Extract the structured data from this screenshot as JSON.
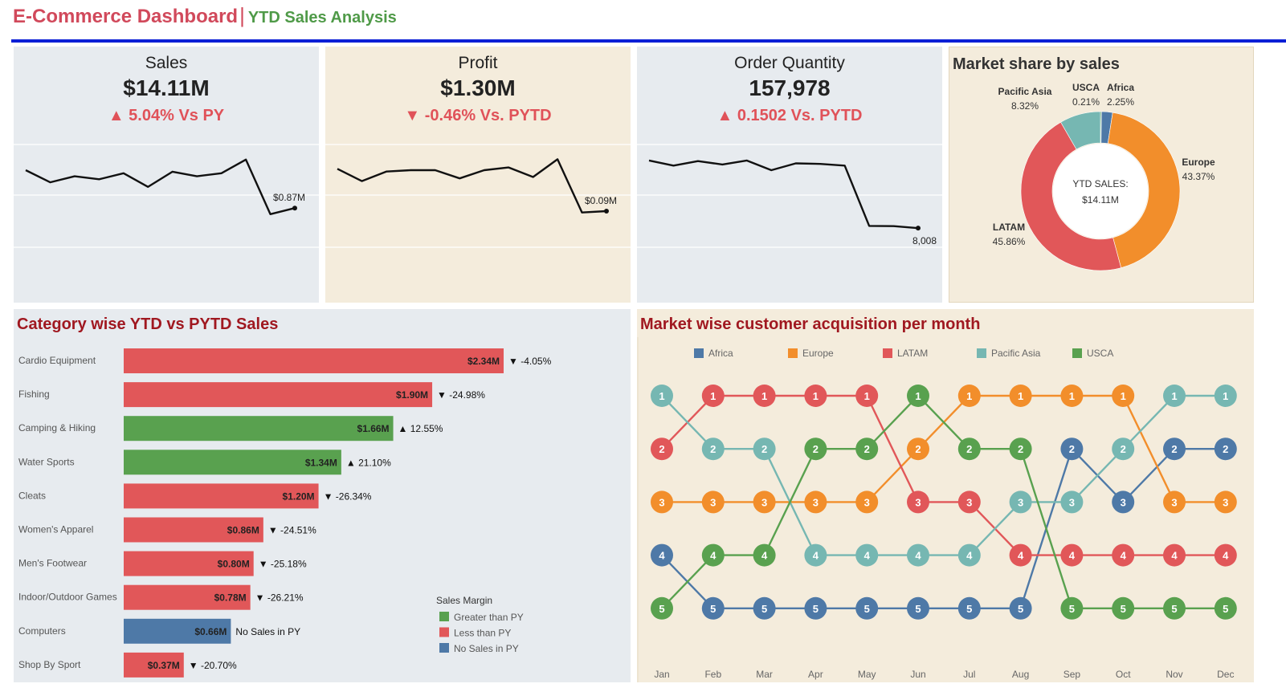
{
  "header": {
    "title": "E-Commerce Dashboard",
    "separator": "|",
    "subtitle": "YTD Sales Analysis"
  },
  "colors": {
    "accent_red": "#d1495b",
    "accent_green": "#4f9a48",
    "rule_blue": "#0b1fd6",
    "bar_green": "#59a14f",
    "bar_red": "#e15759",
    "bar_blue": "#4e79a7",
    "africa": "#4e79a7",
    "europe": "#f28e2b",
    "latam": "#e15759",
    "pacific_asia": "#76b7b2",
    "usca": "#59a14f"
  },
  "kpis": [
    {
      "title": "Sales",
      "value": "$14.11M",
      "delta": "▲ 5.04% Vs PY",
      "end_label": "$0.87M",
      "bg": "#e7ebef"
    },
    {
      "title": "Profit",
      "value": "$1.30M",
      "delta": "▼ -0.46% Vs. PYTD",
      "end_label": "$0.09M",
      "bg": "#f4ecdc"
    },
    {
      "title": "Order Quantity",
      "value": "157,978",
      "delta": "▲ 0.1502 Vs. PYTD",
      "end_label": "8,008",
      "bg": "#e7ebef"
    }
  ],
  "market_share": {
    "title": "Market share by sales",
    "center_label_1": "YTD SALES:",
    "center_label_2": "$14.11M",
    "slices": [
      {
        "name": "Africa",
        "pct_label": "2.25%",
        "value": 2.25,
        "color": "#4e79a7"
      },
      {
        "name": "Europe",
        "pct_label": "43.37%",
        "value": 43.37,
        "color": "#f28e2b"
      },
      {
        "name": "LATAM",
        "pct_label": "45.86%",
        "value": 45.86,
        "color": "#e15759"
      },
      {
        "name": "Pacific Asia",
        "pct_label": "8.32%",
        "value": 8.32,
        "color": "#76b7b2"
      },
      {
        "name": "USCA",
        "pct_label": "0.21%",
        "value": 0.21,
        "color": "#59a14f"
      }
    ]
  },
  "category": {
    "title": "Category wise YTD vs PYTD Sales",
    "legend_title": "Sales Margin",
    "legend": [
      {
        "label": "Greater than PY",
        "color": "#59a14f"
      },
      {
        "label": "Less than PY",
        "color": "#e15759"
      },
      {
        "label": "No Sales in PY",
        "color": "#4e79a7"
      }
    ]
  },
  "acquisition": {
    "title": "Market wise customer acquisition per month"
  },
  "chart_data": [
    {
      "type": "line",
      "title": "Sales",
      "x": [
        "1",
        "2",
        "3",
        "4",
        "5",
        "6",
        "7",
        "8",
        "9",
        "10",
        "11",
        "12"
      ],
      "values": [
        1.12,
        1.04,
        1.08,
        1.06,
        1.1,
        1.01,
        1.11,
        1.08,
        1.1,
        1.19,
        0.83,
        0.87
      ],
      "end_label": "$0.87M",
      "ylim": [
        0.4,
        1.3
      ]
    },
    {
      "type": "line",
      "title": "Profit",
      "x": [
        "1",
        "2",
        "3",
        "4",
        "5",
        "6",
        "7",
        "8",
        "9",
        "10",
        "11",
        "12"
      ],
      "values": [
        0.121,
        0.112,
        0.119,
        0.12,
        0.12,
        0.114,
        0.12,
        0.122,
        0.115,
        0.128,
        0.089,
        0.09
      ],
      "end_label": "$0.09M",
      "ylim": [
        0.04,
        0.14
      ]
    },
    {
      "type": "line",
      "title": "Order Quantity",
      "x": [
        "1",
        "2",
        "3",
        "4",
        "5",
        "6",
        "7",
        "8",
        "9",
        "10",
        "11",
        "12"
      ],
      "values": [
        13950,
        13500,
        13900,
        13600,
        13950,
        13100,
        13700,
        13650,
        13500,
        8200,
        8180,
        8008
      ],
      "end_label": "8,008",
      "ylim": [
        3500,
        15500
      ]
    },
    {
      "type": "pie",
      "title": "Market share by sales",
      "categories": [
        "Africa",
        "Europe",
        "LATAM",
        "Pacific Asia",
        "USCA"
      ],
      "values": [
        2.25,
        43.37,
        45.86,
        8.32,
        0.21
      ]
    },
    {
      "type": "bar",
      "title": "Category wise YTD vs PYTD Sales",
      "categories": [
        "Cardio Equipment",
        "Fishing",
        "Camping & Hiking",
        "Water Sports",
        "Cleats",
        "Women's Apparel",
        "Men's Footwear",
        "Indoor/Outdoor Games",
        "Computers",
        "Shop By Sport"
      ],
      "values": [
        2.34,
        1.9,
        1.66,
        1.34,
        1.2,
        0.86,
        0.8,
        0.78,
        0.66,
        0.37
      ],
      "value_labels": [
        "$2.34M",
        "$1.90M",
        "$1.66M",
        "$1.34M",
        "$1.20M",
        "$0.86M",
        "$0.80M",
        "$0.78M",
        "$0.66M",
        "$0.37M"
      ],
      "change_labels": [
        "▼ -4.05%",
        "▼ -24.98%",
        "▲ 12.55%",
        "▲ 21.10%",
        "▼ -26.34%",
        "▼ -24.51%",
        "▼ -25.18%",
        "▼ -26.21%",
        "No Sales in PY",
        "▼ -20.70%"
      ],
      "margin": [
        "less",
        "less",
        "greater",
        "greater",
        "less",
        "less",
        "less",
        "less",
        "none",
        "less"
      ],
      "xlim": [
        0,
        2.6
      ]
    },
    {
      "type": "line",
      "title": "Market wise customer acquisition per month",
      "x": [
        "Jan",
        "Feb",
        "Mar",
        "Apr",
        "May",
        "Jun",
        "Jul",
        "Aug",
        "Sep",
        "Oct",
        "Nov",
        "Dec"
      ],
      "ylim": [
        1,
        5
      ],
      "series": [
        {
          "name": "Africa",
          "color": "#4e79a7",
          "values": [
            4,
            5,
            5,
            5,
            5,
            5,
            5,
            5,
            2,
            3,
            2,
            2
          ]
        },
        {
          "name": "Europe",
          "color": "#f28e2b",
          "values": [
            3,
            3,
            3,
            3,
            3,
            2,
            1,
            1,
            1,
            1,
            3,
            3
          ]
        },
        {
          "name": "LATAM",
          "color": "#e15759",
          "values": [
            2,
            1,
            1,
            1,
            1,
            3,
            3,
            4,
            4,
            4,
            4,
            4
          ]
        },
        {
          "name": "Pacific Asia",
          "color": "#76b7b2",
          "values": [
            1,
            2,
            2,
            4,
            4,
            4,
            4,
            3,
            3,
            2,
            1,
            1
          ]
        },
        {
          "name": "USCA",
          "color": "#59a14f",
          "values": [
            5,
            4,
            4,
            2,
            2,
            1,
            2,
            2,
            5,
            5,
            5,
            5
          ]
        }
      ]
    }
  ]
}
